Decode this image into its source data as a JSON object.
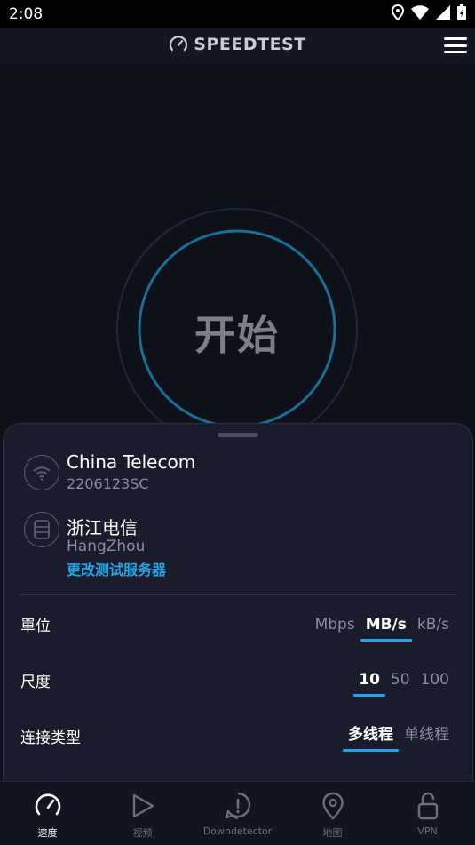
{
  "status_bar": {
    "time": "2:08"
  },
  "header": {
    "brand": "SPEEDTEST",
    "icons": [
      "speedometer-icon",
      "hamburger-menu-icon"
    ]
  },
  "gauge": {
    "button_label": "开始"
  },
  "connection": {
    "isp_name": "China Telecom",
    "ip_label": "2206123SC",
    "server_name": "浙江电信",
    "server_city": "HangZhou",
    "change_server": "更改测试服务器"
  },
  "settings": {
    "units": {
      "label": "單位",
      "options": [
        "Mbps",
        "MB/s",
        "kB/s"
      ],
      "selected": "MB/s"
    },
    "scale": {
      "label": "尺度",
      "options": [
        "10",
        "50",
        "100"
      ],
      "selected": "10"
    },
    "connection_type": {
      "label": "连接类型",
      "options": [
        "多线程",
        "单线程"
      ],
      "selected": "多线程"
    }
  },
  "bottom_nav": {
    "items": [
      {
        "label": "速度",
        "icon": "speedometer-icon",
        "active": true
      },
      {
        "label": "视频",
        "icon": "play-icon",
        "active": false
      },
      {
        "label": "Downdetector",
        "icon": "alert-icon",
        "active": false
      },
      {
        "label": "地图",
        "icon": "map-pin-icon",
        "active": false
      },
      {
        "label": "VPN",
        "icon": "unlock-icon",
        "active": false
      }
    ]
  },
  "colors": {
    "accent": "#1fa6e8",
    "background": "#0f111a",
    "sheet": "#1a1c2b"
  }
}
